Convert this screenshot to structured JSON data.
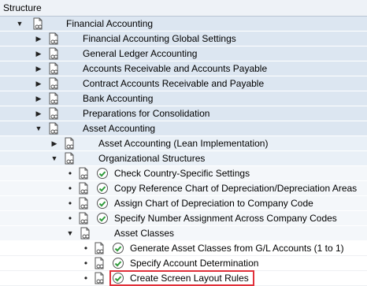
{
  "header": {
    "title": "Structure"
  },
  "tree": {
    "root": "Financial Accounting",
    "level1": [
      "Financial Accounting Global Settings",
      "General Ledger Accounting",
      "Accounts Receivable and Accounts Payable",
      "Contract Accounts Receivable and Payable",
      "Bank Accounting",
      "Preparations for Consolidation",
      "Asset Accounting"
    ],
    "level2": [
      "Asset Accounting (Lean Implementation)",
      "Organizational Structures"
    ],
    "level3": [
      "Check Country-Specific Settings",
      "Copy Reference Chart of Depreciation/Depreciation Areas",
      "Assign Chart of Depreciation to Company Code",
      "Specify Number Assignment Across Company Codes",
      "Asset Classes"
    ],
    "level4": [
      "Generate Asset Classes from G/L Accounts (1 to 1)",
      "Specify Account Determination",
      "Create Screen Layout Rules"
    ]
  },
  "colors": {
    "highlight_border": "#e0303a",
    "clock_green": "#2e9a3a"
  },
  "icons": {
    "expanded": "triangle-down-icon",
    "collapsed": "triangle-right-icon",
    "document": "document-glasses-icon",
    "activity": "clock-check-icon"
  }
}
